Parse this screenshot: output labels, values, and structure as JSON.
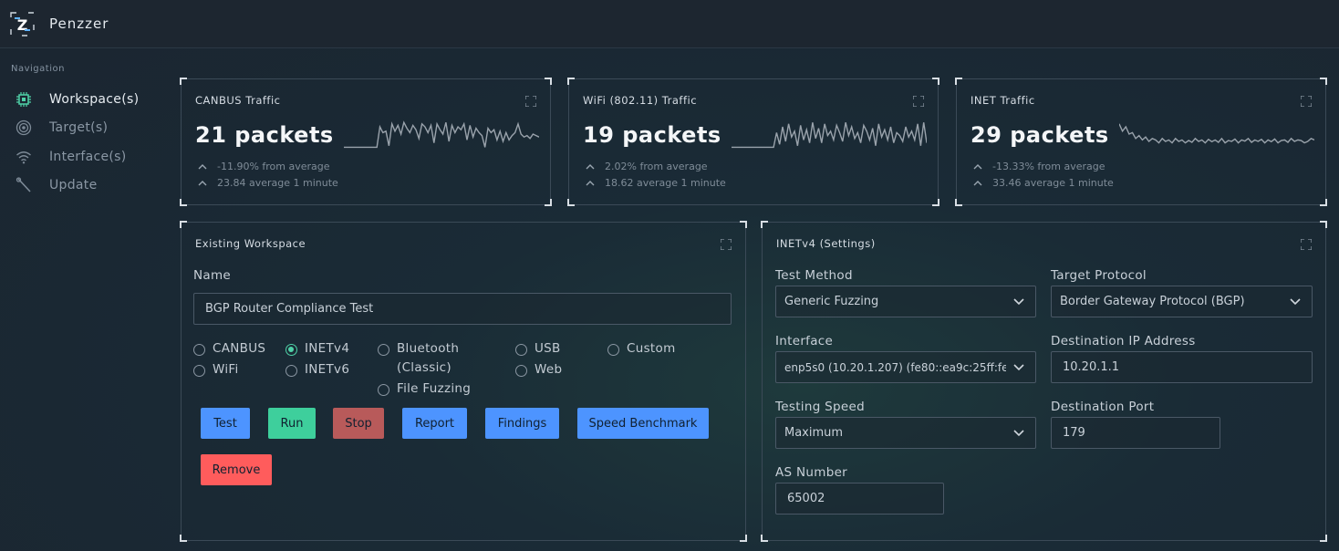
{
  "app": {
    "title": "Penzzer"
  },
  "nav": {
    "heading": "Navigation",
    "items": [
      {
        "label": "Workspace(s)",
        "icon": "chip-icon",
        "active": true
      },
      {
        "label": "Target(s)",
        "icon": "target-icon",
        "active": false
      },
      {
        "label": "Interface(s)",
        "icon": "wifi-icon",
        "active": false
      },
      {
        "label": "Update",
        "icon": "wrench-icon",
        "active": false
      }
    ]
  },
  "traffic": [
    {
      "title": "CANBUS Traffic",
      "packets": "21 packets",
      "change": "-11.90% from average",
      "average": "23.84 average 1 minute",
      "spark": [
        0.05,
        0.05,
        0.05,
        0.05,
        0.05,
        0.05,
        0.05,
        0.05,
        0.05,
        0.05,
        0.05,
        0.05,
        0.75,
        0.55,
        0.6,
        0.1,
        0.85,
        0.6,
        0.8,
        0.5,
        0.9,
        0.7,
        0.55,
        0.8,
        0.65,
        0.35,
        0.85,
        0.75,
        0.55,
        0.8,
        0.2,
        0.85,
        0.65,
        0.5,
        0.9,
        0.25,
        0.8,
        0.55,
        0.75,
        0.65,
        0.85,
        0.3,
        0.8,
        0.4,
        0.7,
        0.55,
        0.45,
        0.05,
        0.7,
        0.55,
        0.65,
        0.3,
        0.6,
        0.25,
        0.55,
        0.3,
        0.45,
        0.55,
        0.85,
        0.5,
        0.4,
        0.45,
        0.35,
        0.5,
        0.45,
        0.4
      ]
    },
    {
      "title": "WiFi (802.11) Traffic",
      "packets": "19 packets",
      "change": "2.02% from average",
      "average": "18.62 average 1 minute",
      "spark": [
        0.05,
        0.05,
        0.05,
        0.05,
        0.05,
        0.05,
        0.05,
        0.05,
        0.05,
        0.05,
        0.05,
        0.05,
        0.05,
        0.05,
        0.05,
        0.55,
        0.15,
        0.75,
        0.25,
        0.85,
        0.4,
        0.6,
        0.1,
        0.8,
        0.3,
        0.65,
        0.2,
        0.9,
        0.35,
        0.7,
        0.2,
        0.85,
        0.45,
        0.6,
        0.3,
        0.8,
        0.55,
        0.25,
        0.9,
        0.45,
        0.75,
        0.35,
        0.55,
        0.2,
        0.8,
        0.6,
        0.3,
        0.7,
        0.1,
        0.85,
        0.4,
        0.65,
        0.3,
        0.75,
        0.2,
        0.55,
        0.45,
        0.25,
        0.75,
        0.4,
        0.6,
        0.3,
        0.85,
        0.1,
        0.9,
        0.2
      ]
    },
    {
      "title": "INET Traffic",
      "packets": "29 packets",
      "change": "-13.33% from average",
      "average": "33.46 average 1 minute",
      "spark": [
        0.85,
        0.6,
        0.75,
        0.5,
        0.55,
        0.35,
        0.45,
        0.3,
        0.4,
        0.25,
        0.35,
        0.3,
        0.2,
        0.35,
        0.25,
        0.3,
        0.2,
        0.35,
        0.25,
        0.3,
        0.2,
        0.28,
        0.22,
        0.35,
        0.25,
        0.3,
        0.2,
        0.32,
        0.24,
        0.3,
        0.22,
        0.35,
        0.2,
        0.28,
        0.25,
        0.33,
        0.2,
        0.3,
        0.26,
        0.35,
        0.22,
        0.3,
        0.25,
        0.32,
        0.2,
        0.3,
        0.24,
        0.33,
        0.2,
        0.28,
        0.3,
        0.22,
        0.35,
        0.25,
        0.3,
        0.28,
        0.2,
        0.25,
        0.35,
        0.3
      ]
    }
  ],
  "workspace": {
    "title": "Existing Workspace",
    "name_label": "Name",
    "name_value": "BGP Router Compliance Test",
    "radios": [
      {
        "label": "CANBUS",
        "checked": false
      },
      {
        "label": "INETv4",
        "checked": true
      },
      {
        "label": "Bluetooth (Classic)",
        "checked": false
      },
      {
        "label": "USB",
        "checked": false
      },
      {
        "label": "Custom",
        "checked": false
      },
      {
        "label": "WiFi",
        "checked": false
      },
      {
        "label": "INETv6",
        "checked": false
      },
      {
        "label": "Web",
        "checked": false
      },
      {
        "label": "File Fuzzing",
        "checked": false
      }
    ],
    "buttons": {
      "test": "Test",
      "run": "Run",
      "stop": "Stop",
      "report": "Report",
      "findings": "Findings",
      "speed": "Speed Benchmark",
      "remove": "Remove"
    }
  },
  "settings": {
    "title": "INETv4 (Settings)",
    "test_method_label": "Test Method",
    "test_method_value": "Generic Fuzzing",
    "target_protocol_label": "Target Protocol",
    "target_protocol_value": "Border Gateway Protocol (BGP)",
    "interface_label": "Interface",
    "interface_value": "enp5s0 (10.20.1.207) (fe80::ea9c:25ff:fe",
    "dest_ip_label": "Destination IP Address",
    "dest_ip_value": "10.20.1.1",
    "speed_label": "Testing Speed",
    "speed_value": "Maximum",
    "dest_port_label": "Destination Port",
    "dest_port_value": "179",
    "as_label": "AS Number",
    "as_value": "65002"
  },
  "colors": {
    "accent_green": "#4fd1a7",
    "button_blue": "#4d94ff",
    "button_green": "#3ecf9c",
    "button_stop": "#b85a5a",
    "button_red": "#ff5c5c"
  }
}
